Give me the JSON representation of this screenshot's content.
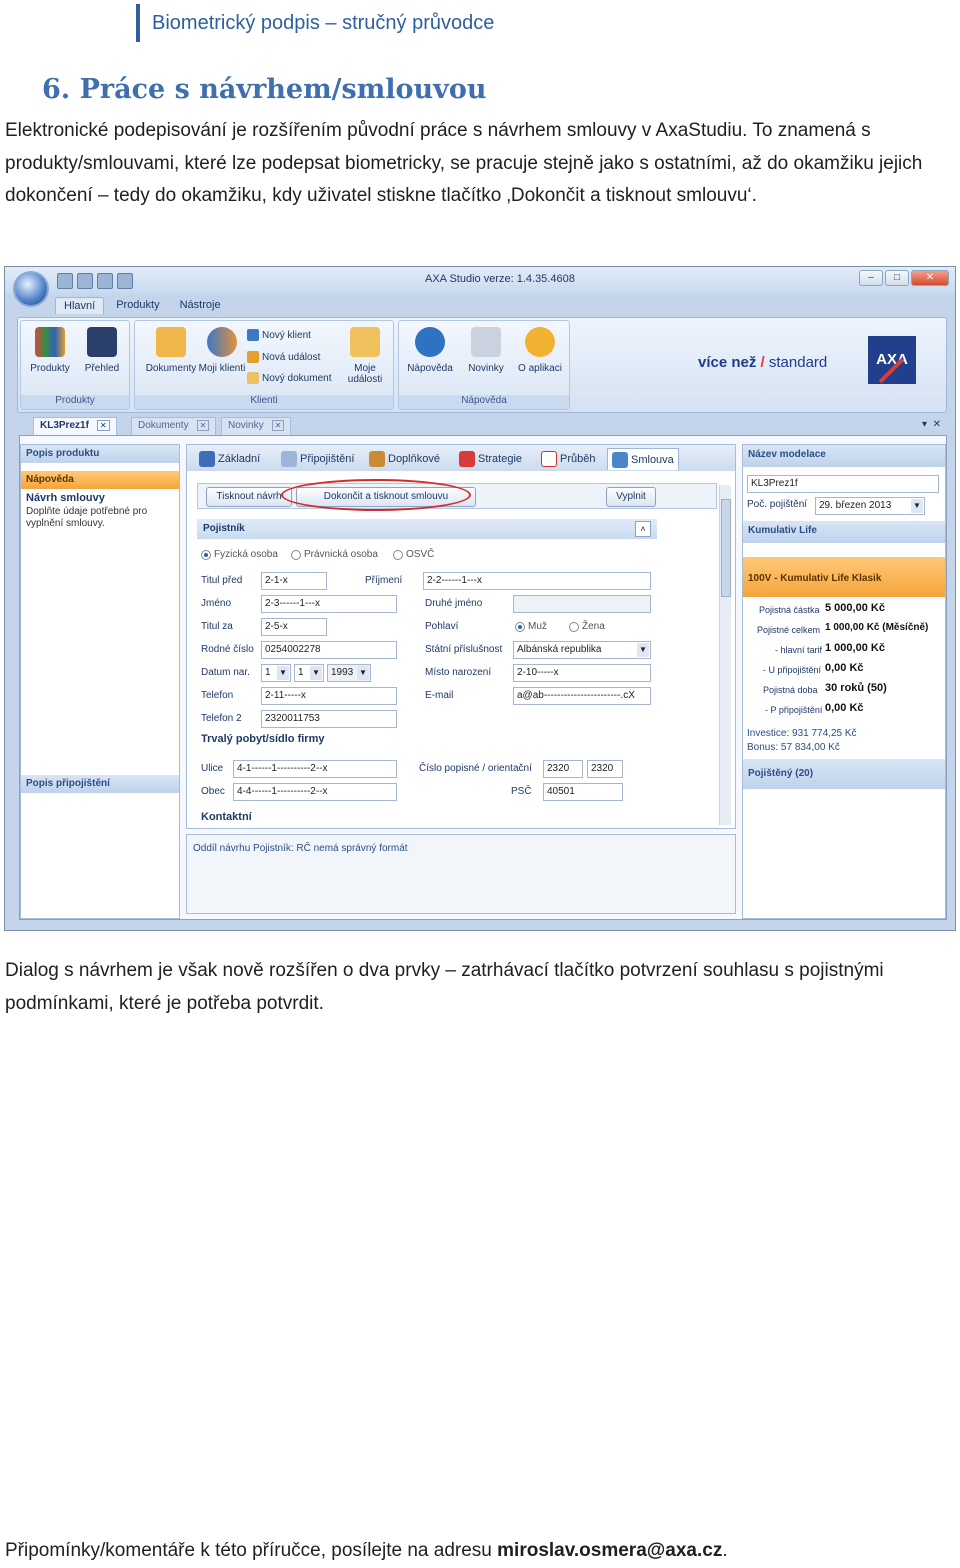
{
  "header": {
    "title": "Biometrický podpis – stručný průvodce"
  },
  "section": {
    "title": "6.  Práce s návrhem/smlouvou"
  },
  "intro_text": "Elektronické podepisování je rozšířením původní práce s návrhem smlouvy v AxaStudiu. To znamená s produkty/smlouvami, které lze podepsat biometricky, se pracuje stejně jako s ostatními, až do okamžiku jejich dokončení – tedy do okamžiku, kdy uživatel stiskne tlačítko ‚Dokončit a tisknout smlouvu‘.",
  "after_text": "Dialog s návrhem je však nově rozšířen o dva prvky – zatrhávací tlačítko potvrzení souhlasu s pojistnými podmínkami, které je potřeba potvrdit.",
  "footer": {
    "text": "Připomínky/komentáře k této příručce, posílejte na adresu ",
    "email": "miroslav.osmera@axa.cz",
    "suffix": "."
  },
  "app": {
    "window_title": "AXA Studio   verze: 1.4.35.4608",
    "ribbon_tabs": [
      "Hlavní",
      "Produkty",
      "Nástroje"
    ],
    "ribbon": {
      "produkty": "Produkty",
      "prehled": "Přehled",
      "group_produkty": "Produkty",
      "dokumenty": "Dokumenty",
      "moji_klienti": "Moji klienti",
      "novy_klient": "Nový klient",
      "nova_udalost": "Nová událost",
      "novy_dokument": "Nový dokument",
      "moje_udalosti": "Moje události",
      "group_klienti": "Klienti",
      "napoveda": "Nápověda",
      "novinky": "Novinky",
      "o_aplikaci": "O aplikaci",
      "group_napoveda": "Nápověda"
    },
    "brand": {
      "part1": "více než",
      "slash": "/",
      "part2": "standard",
      "logo": "AXA"
    },
    "doc_tabs": [
      "KL3Prez1f",
      "Dokumenty",
      "Novinky"
    ],
    "left_panel": {
      "popis_produktu": "Popis produktu",
      "napoveda": "Nápověda",
      "navrh_smlouvy": "Návrh smlouvy",
      "desc": "Doplňte údaje potřebné pro vyplnění smlouvy.",
      "popis_pripojisteni": "Popis připojištění"
    },
    "form_tabs": [
      "Základní",
      "Připojištění",
      "Doplňkové",
      "Strategie",
      "Průběh",
      "Smlouva"
    ],
    "buttons": {
      "tisknout": "Tisknout návrh",
      "dokoncit": "Dokončit a tisknout smlouvu",
      "vyplnit": "Vyplnit"
    },
    "pojistnik": {
      "title": "Pojistník",
      "radios": [
        "Fyzická osoba",
        "Právnická osoba",
        "OSVČ"
      ],
      "titul_pred": "Titul před",
      "titul_pred_v": "2-1-x",
      "jmeno": "Jméno",
      "jmeno_v": "2-3------1---x",
      "titul_za": "Titul za",
      "titul_za_v": "2-5-x",
      "rodne_cislo": "Rodné číslo",
      "rodne_cislo_v": "0254002278",
      "datum_nar": "Datum nar.",
      "den": "1",
      "mesic": "1",
      "rok": "1993",
      "telefon": "Telefon",
      "telefon_v": "2-11-----x",
      "telefon2": "Telefon 2",
      "telefon2_v": "2320011753",
      "prijmeni": "Příjmení",
      "prijmeni_v": "2-2------1---x",
      "druhe_jmeno": "Druhé jméno",
      "pohlavi": "Pohlaví",
      "muz": "Muž",
      "zena": "Žena",
      "statni_prislusnost": "Státní příslušnost",
      "statni_prislusnost_v": "Albánská republika",
      "misto_narozeni": "Místo narození",
      "misto_narozeni_v": "2-10-----x",
      "email": "E-mail",
      "email_v": "a@ab-----------------------.cX",
      "trvaly_pobyt": "Trvalý pobyt/sídlo firmy",
      "ulice": "Ulice",
      "ulice_v": "4-1------1----------2--x",
      "obec": "Obec",
      "obec_v": "4-4------1----------2--x",
      "cislo_popisne": "Číslo popisné / orientační",
      "cislo_popisne_v": "2320",
      "cislo_orientacni_v": "2320",
      "psc": "PSČ",
      "psc_v": "40501",
      "kontakt": "Kontaktní"
    },
    "status_msg": "Oddíl návrhu Pojistník: RČ nemá správný formát",
    "right_panel": {
      "nazev_modelace": "Název modelace",
      "nazev_v": "KL3Prez1f",
      "poc_pojisteni": "Poč. pojištění",
      "poc_v": "29. březen 2013",
      "kumulativ": "Kumulativ Life",
      "produkt": "100V - Kumulativ Life Klasik",
      "rows": [
        {
          "label": "Pojistná částka",
          "value": "5 000,00 Kč"
        },
        {
          "label": "Pojistné celkem",
          "value": "1 000,00 Kč (Měsíčně)"
        },
        {
          "label": "- hlavní tarif",
          "value": "1 000,00 Kč"
        },
        {
          "label": "- U připojištění",
          "value": "0,00 Kč"
        },
        {
          "label": "Pojistná doba",
          "value": "30 roků (50)"
        },
        {
          "label": "- P připojištění",
          "value": "0,00 Kč"
        }
      ],
      "investice": "Investice:  931 774,25 Kč",
      "bonus": "Bonus:  57 834,00 Kč",
      "pojisteny": "Pojištěný  (20)"
    }
  }
}
